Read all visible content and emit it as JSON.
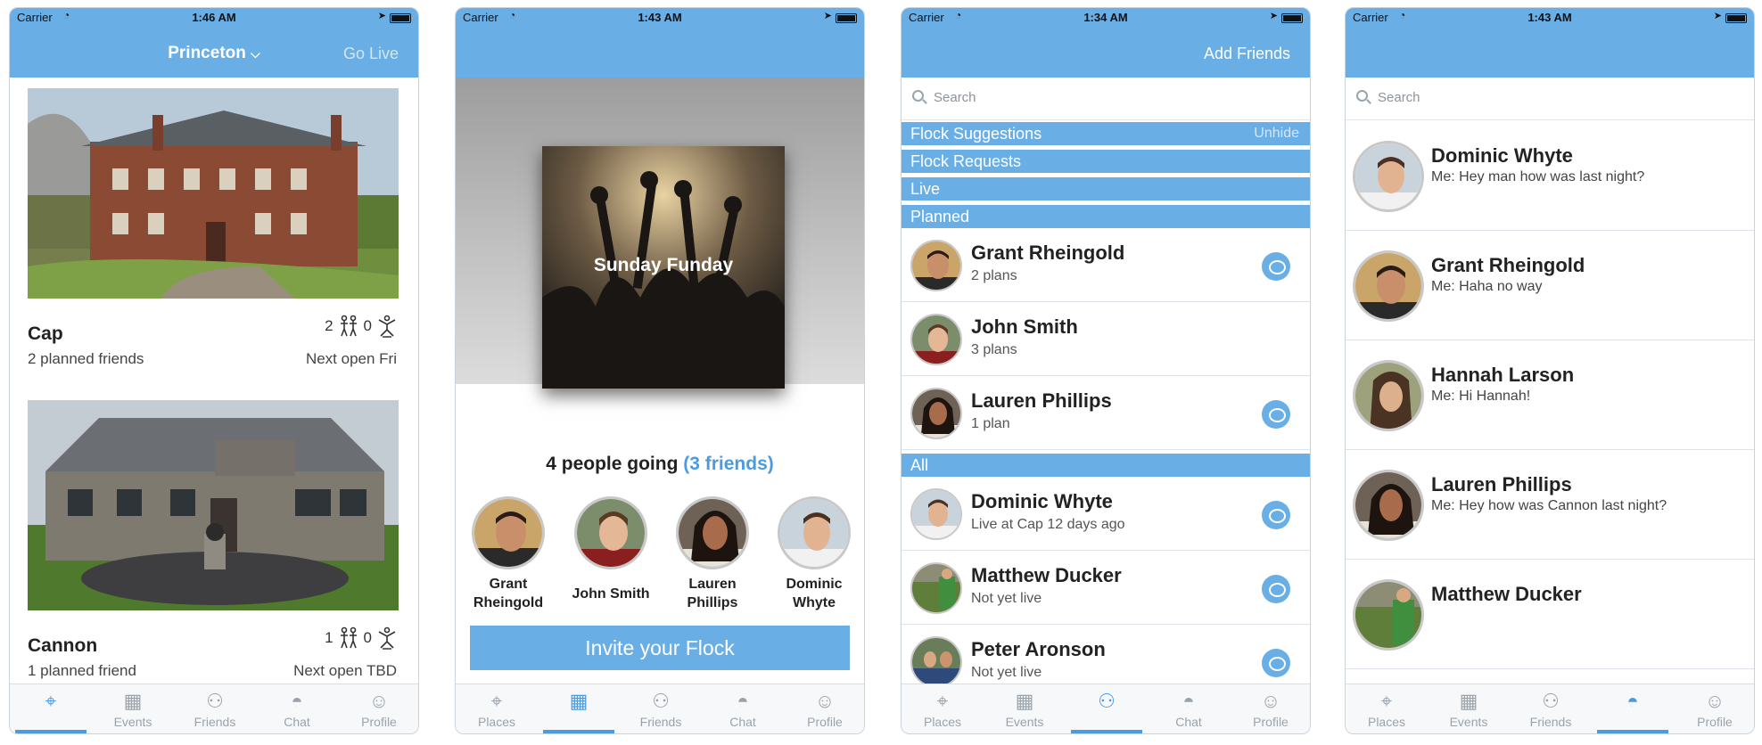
{
  "status": {
    "carrier": "Carrier"
  },
  "screens": {
    "places": {
      "time": "1:46 AM",
      "title": "Princeton",
      "right_action": "Go Live",
      "places": [
        {
          "name": "Cap",
          "planned": "2 planned friends",
          "going_count": "2",
          "live_count": "0",
          "open": "Next open Fri"
        },
        {
          "name": "Cannon",
          "planned": "1 planned friend",
          "going_count": "1",
          "live_count": "0",
          "open": "Next open TBD"
        }
      ]
    },
    "events": {
      "time": "1:43 AM",
      "event_title": "Sunday Funday",
      "going_text": "4 people going",
      "friends_text": "(3 friends)",
      "attendees": [
        {
          "first": "Grant",
          "last": "Rheingold"
        },
        {
          "first": "John Smith",
          "last": ""
        },
        {
          "first": "Lauren",
          "last": "Phillips"
        },
        {
          "first": "Dominic",
          "last": "Whyte"
        }
      ],
      "invite_label": "Invite your Flock"
    },
    "friends": {
      "time": "1:34 AM",
      "right_action": "Add Friends",
      "search_placeholder": "Search",
      "sections": {
        "suggestions": "Flock Suggestions",
        "unhide": "Unhide",
        "requests": "Flock Requests",
        "live": "Live",
        "planned": "Planned",
        "all": "All"
      },
      "planned": [
        {
          "name": "Grant Rheingold",
          "sub": "2 plans"
        },
        {
          "name": "John Smith",
          "sub": "3 plans"
        },
        {
          "name": "Lauren Phillips",
          "sub": "1 plan"
        }
      ],
      "all": [
        {
          "name": "Dominic Whyte",
          "sub": "Live at Cap 12 days ago"
        },
        {
          "name": "Matthew Ducker",
          "sub": "Not yet live"
        },
        {
          "name": "Peter Aronson",
          "sub": "Not yet live"
        }
      ]
    },
    "chat": {
      "time": "1:43 AM",
      "search_placeholder": "Search",
      "conversations": [
        {
          "name": "Dominic Whyte",
          "preview": "Me: Hey man how was last night?"
        },
        {
          "name": "Grant Rheingold",
          "preview": "Me: Haha no way"
        },
        {
          "name": "Hannah Larson",
          "preview": "Me: Hi Hannah!"
        },
        {
          "name": "Lauren Phillips",
          "preview": "Me: Hey how was Cannon last night?"
        },
        {
          "name": "Matthew Ducker",
          "preview": ""
        }
      ]
    }
  },
  "tabs": {
    "places": "Places",
    "events": "Events",
    "friends": "Friends",
    "chat": "Chat",
    "profile": "Profile"
  },
  "icons": {
    "places": "map-pin-icon",
    "events": "calendar-icon",
    "friends": "people-icon",
    "chat": "chat-bubble-icon",
    "profile": "person-icon"
  },
  "colors": {
    "brand_blue": "#6aaee6",
    "active_tab": "#4a9be0",
    "inactive_tab": "#9aa3ab"
  }
}
